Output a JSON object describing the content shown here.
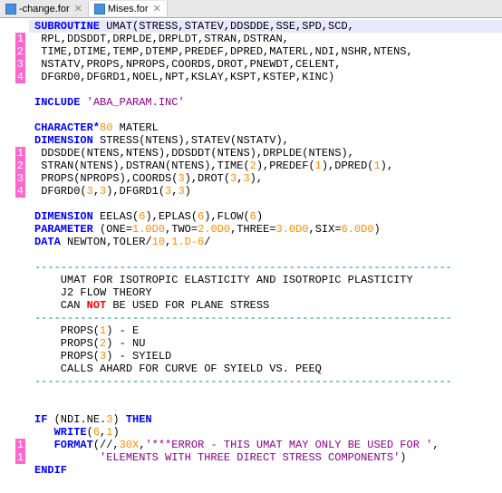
{
  "tabs": {
    "t0_label": "-change.for",
    "t1_label": "Mises.for"
  },
  "marks": {
    "m1": "1",
    "m2": "2",
    "m3": "3",
    "m4": "4"
  },
  "c": {
    "l1a": "SUBROUTINE",
    "l1b": " UMAT(STRESS,STATEV,DDSDDE,SSE,SPD,SCD,",
    "l2": " RPL,DDSDDT,DRPLDE,DRPLDT,STRAN,DSTRAN,",
    "l3": " TIME,DTIME,TEMP,DTEMP,PREDEF,DPRED,MATERL,NDI,NSHR,NTENS,",
    "l4": " NSTATV,PROPS,NPROPS,COORDS,DROT,PNEWDT,CELENT,",
    "l5": " DFGRD0,DFGRD1,NOEL,NPT,KSLAY,KSPT,KSTEP,KINC)",
    "l7a": "INCLUDE",
    "l7b": " 'ABA_PARAM.INC'",
    "l9a": "CHARACTER*",
    "l9n": "80",
    "l9b": " MATERL",
    "l10a": "DIMENSION",
    "l10b": " STRESS(NTENS),STATEV(NSTATV),",
    "l11a": " DDSDDE(NTENS,NTENS),DDSDDT(NTENS),DRPLDE(NTENS),",
    "l12a": " STRAN(NTENS),DSTRAN(NTENS),TIME(",
    "l12n1": "2",
    "l12b": "),PREDEF(",
    "l12n2": "1",
    "l12c": "),DPRED(",
    "l12n3": "1",
    "l12d": "),",
    "l13a": " PROPS(NPROPS),COORDS(",
    "l13n1": "3",
    "l13b": "),DROT(",
    "l13n2": "3",
    "l13c": ",",
    "l13n3": "3",
    "l13d": "),",
    "l14a": " DFGRD0(",
    "l14n1": "3",
    "l14b": ",",
    "l14n2": "3",
    "l14c": "),DFGRD1(",
    "l14n3": "3",
    "l14d": ",",
    "l14n4": "3",
    "l14e": ")",
    "l16a": "DIMENSION",
    "l16b": " EELAS(",
    "l16n1": "6",
    "l16c": "),EPLAS(",
    "l16n2": "6",
    "l16d": "),FLOW(",
    "l16n3": "6",
    "l16e": ")",
    "l17a": "PARAMETER",
    "l17b": " (ONE=",
    "l17n1": "1.0D0",
    "l17c": ",TWO=",
    "l17n2": "2.0D0",
    "l17d": ",THREE=",
    "l17n3": "3.0D0",
    "l17e": ",SIX=",
    "l17n4": "6.0D0",
    "l17f": ")",
    "l18a": "DATA",
    "l18b": " NEWTON,TOLER/",
    "l18n1": "10",
    "l18c": ",",
    "l18n2": "1.D-6",
    "l18d": "/",
    "dash": "----------------------------------------------------------------",
    "c1": "    UMAT FOR ISOTROPIC ELASTICITY AND ISOTROPIC PLASTICITY",
    "c2": "    J2 FLOW THEORY",
    "c3a": "    CAN ",
    "c3not": "NOT",
    "c3b": " BE USED FOR PLANE STRESS",
    "p1a": "    PROPS(",
    "p1n": "1",
    "p1b": ") - E",
    "p2a": "    PROPS(",
    "p2n": "2",
    "p2b": ") - NU",
    "p3a": "    PROPS(",
    "p3n": "3",
    "p3b": ") - SYIELD",
    "p4": "    CALLS AHARD FOR CURVE OF SYIELD VS. PEEQ",
    "if1a": "IF",
    "if1b": " (NDI.NE.",
    "if1n": "3",
    "if1c": ") ",
    "if1d": "THEN",
    "wr1a": "WRITE",
    "wr1b": "(",
    "wr1n1": "6",
    "wr1c": ",",
    "wr1n2": "1",
    "wr1d": ")",
    "fmt1a": "FORMAT",
    "fmt1b": "(//,",
    "fmt1n": "30X",
    "fmt1c": ",",
    "fmt1s1": "'***ERROR - THIS UMAT MAY ONLY BE USED FOR '",
    "fmt1d": ",",
    "fmt2a": "          ",
    "fmt2s": "'ELEMENTS WITH THREE DIRECT STRESS COMPONENTS'",
    "fmt2b": ")",
    "endif": "ENDIF"
  }
}
